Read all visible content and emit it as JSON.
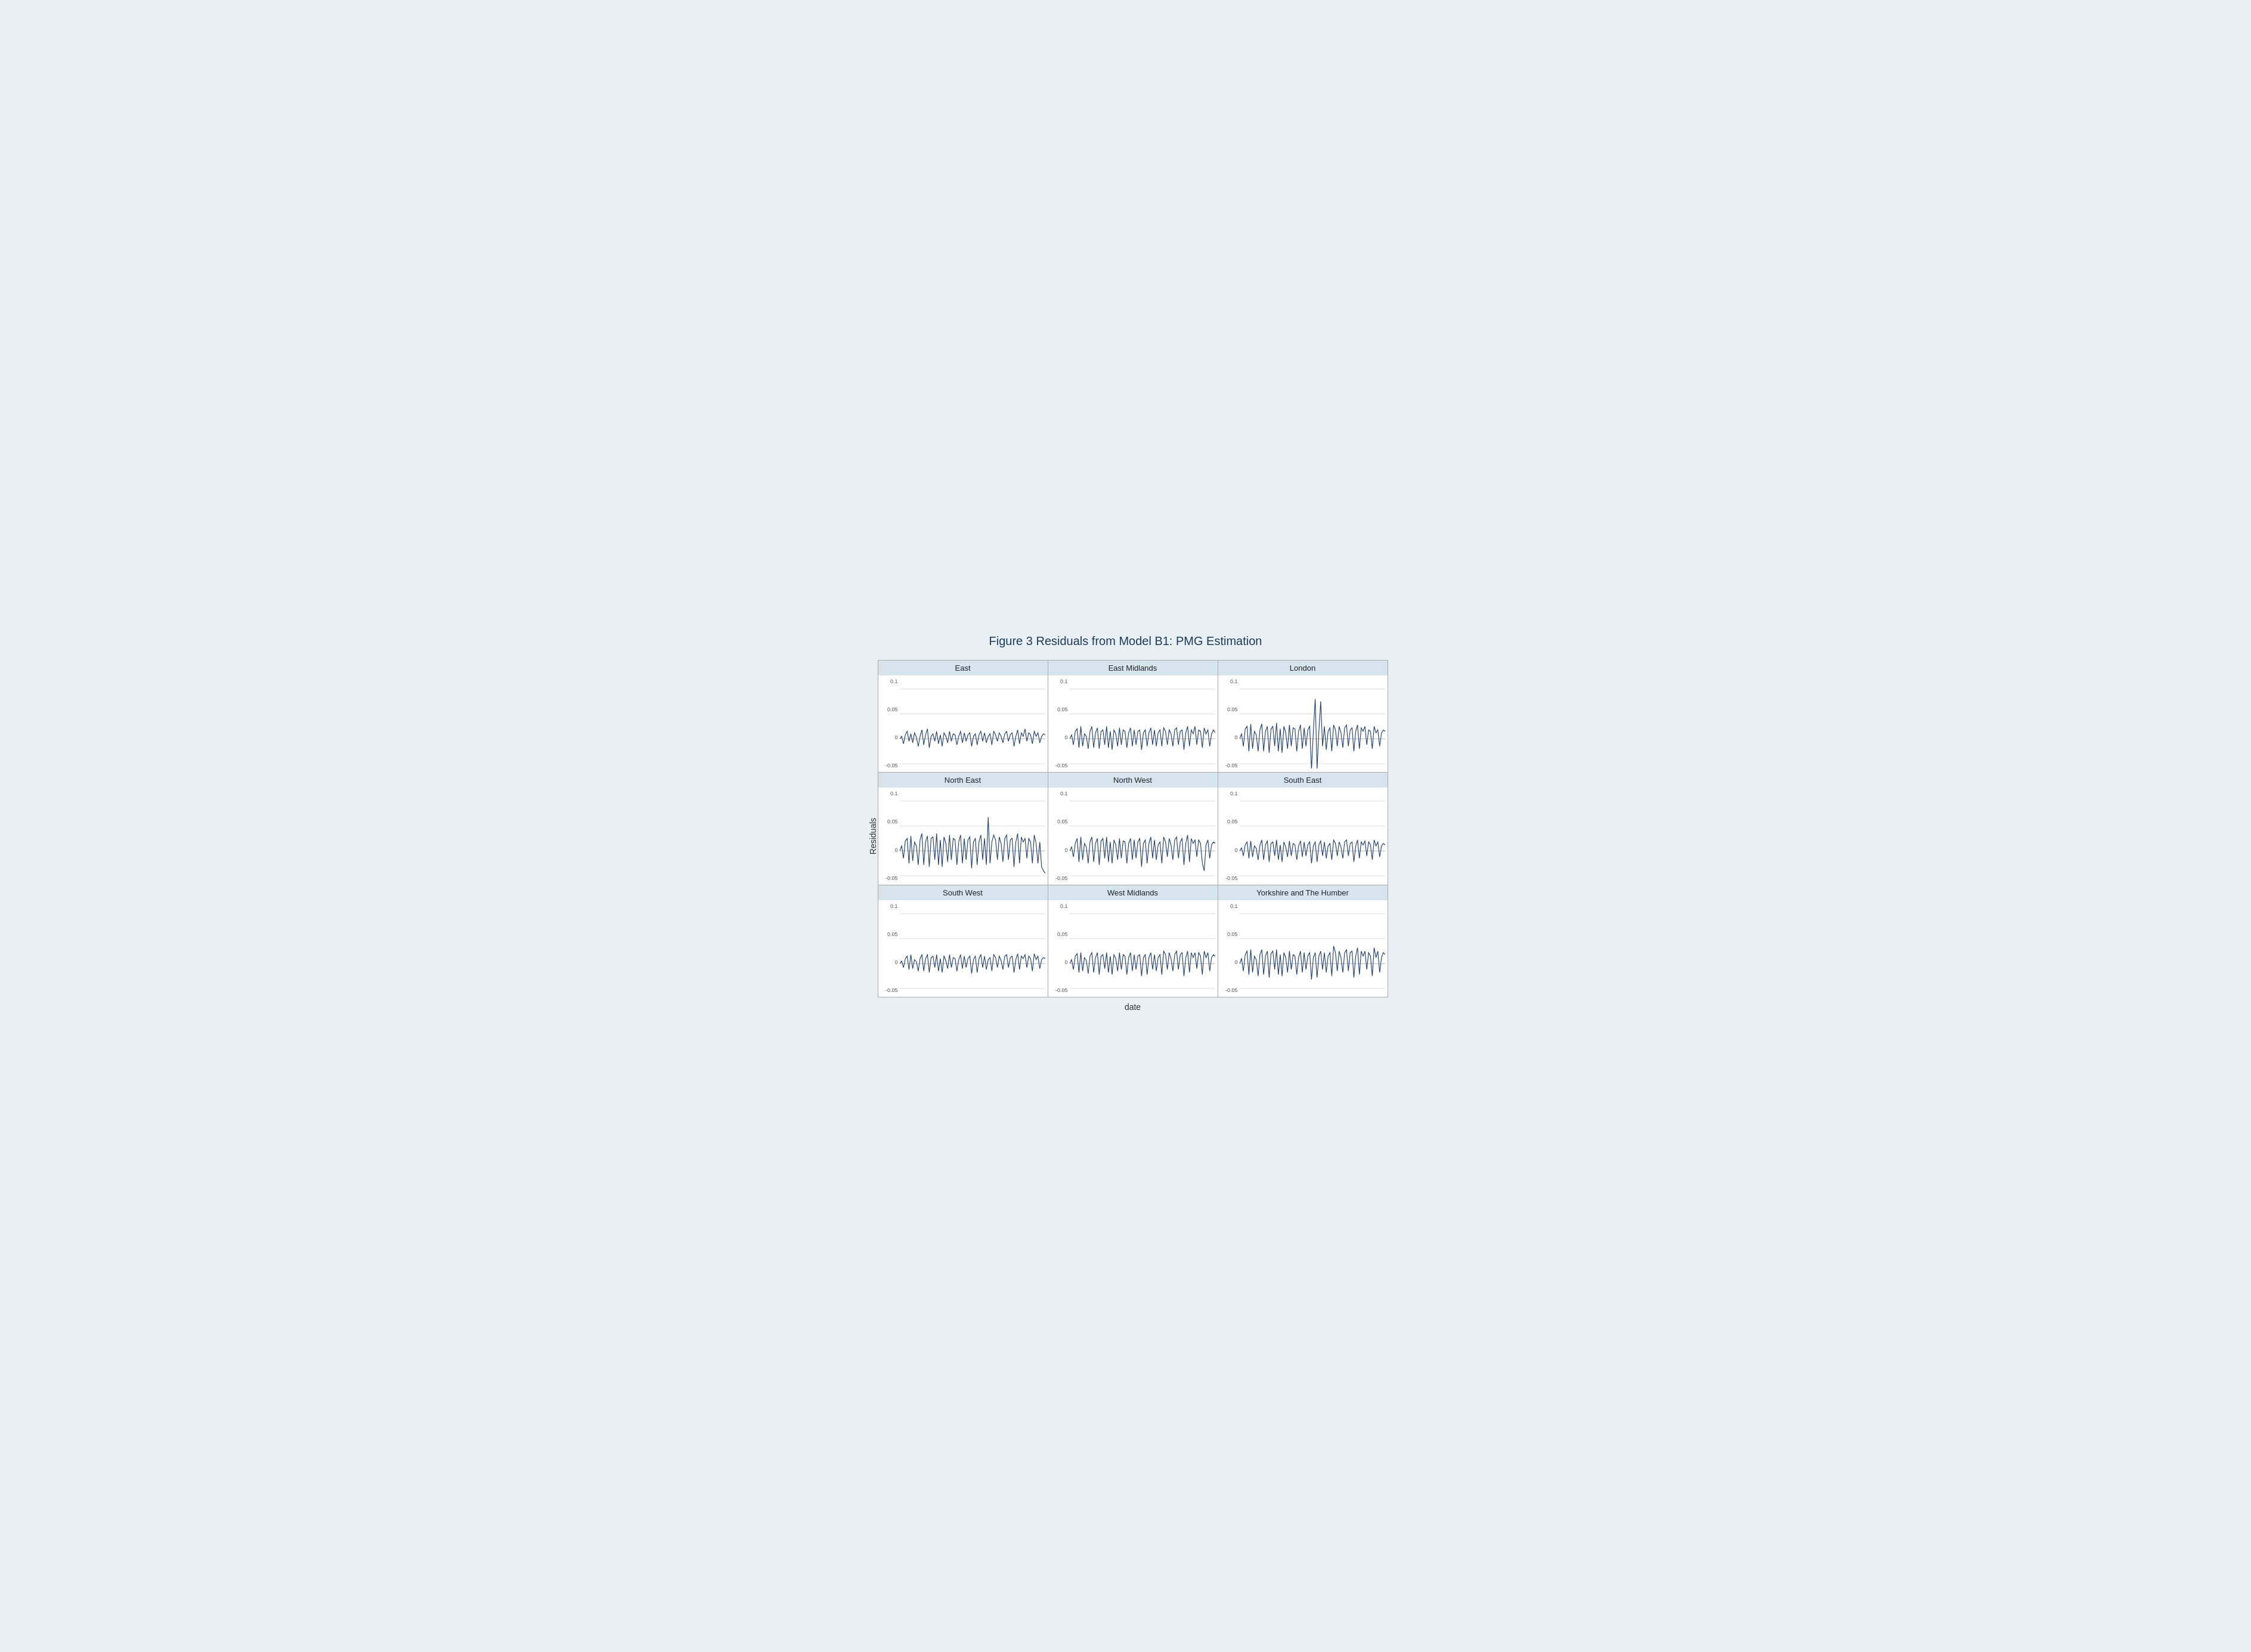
{
  "figure": {
    "title": "Figure 3 Residuals from Model B1: PMG Estimation",
    "y_axis_label": "Residuals",
    "x_axis_label": "date",
    "y_ticks": [
      "0.1",
      "0.05",
      "0",
      "-0.05"
    ],
    "panels": [
      {
        "title": "East",
        "data": [
          0,
          0.005,
          -0.01,
          0.008,
          0.015,
          -0.005,
          0.01,
          -0.008,
          0.012,
          0.003,
          -0.015,
          0.005,
          0.018,
          -0.012,
          0.008,
          0.02,
          -0.018,
          0.005,
          0.01,
          -0.005,
          0.015,
          -0.01,
          0.008,
          -0.015,
          0.012,
          0.005,
          -0.008,
          0.015,
          -0.005,
          0.01,
          0.008,
          -0.012,
          0.005,
          0.015,
          -0.008,
          0.012,
          -0.005,
          0.008,
          0.012,
          -0.015,
          0.005,
          0.01,
          -0.012,
          0.008,
          0.015,
          -0.005,
          0.012,
          -0.008,
          0.005,
          0.01,
          -0.012,
          0.015,
          0.008,
          -0.005,
          0.012,
          0.005,
          -0.008,
          0.01,
          0.015,
          -0.005,
          0.008,
          0.012,
          -0.015,
          0.005,
          0.018,
          -0.01,
          0.012,
          0.005,
          0.02,
          -0.005,
          0.012,
          0.008,
          -0.01,
          0.015,
          0.005,
          0.012,
          -0.008,
          0.005,
          0.01,
          0.008
        ]
      },
      {
        "title": "East Midlands",
        "data": [
          0,
          0.008,
          -0.012,
          0.015,
          0.02,
          -0.018,
          0.025,
          -0.015,
          0.01,
          0.005,
          -0.02,
          0.015,
          0.025,
          -0.018,
          0.012,
          0.022,
          -0.02,
          0.015,
          0.018,
          -0.012,
          0.025,
          -0.018,
          0.015,
          -0.022,
          0.018,
          0.01,
          -0.015,
          0.022,
          -0.012,
          0.018,
          0.015,
          -0.018,
          0.012,
          0.022,
          -0.015,
          0.018,
          -0.012,
          0.015,
          0.018,
          -0.022,
          0.012,
          0.018,
          -0.015,
          0.012,
          0.022,
          -0.012,
          0.018,
          -0.015,
          0.012,
          0.018,
          -0.015,
          0.022,
          0.015,
          -0.012,
          0.018,
          0.01,
          -0.015,
          0.018,
          0.022,
          -0.012,
          0.015,
          0.018,
          -0.022,
          0.012,
          0.025,
          -0.015,
          0.018,
          0.01,
          0.025,
          -0.012,
          0.018,
          0.015,
          -0.018,
          0.022,
          0.01,
          0.018,
          -0.015,
          0.01,
          0.018,
          0.012
        ]
      },
      {
        "title": "London",
        "data": [
          0,
          0.01,
          -0.015,
          0.02,
          0.025,
          -0.025,
          0.03,
          -0.02,
          0.015,
          0.008,
          -0.025,
          0.018,
          0.03,
          -0.025,
          0.015,
          0.025,
          -0.028,
          0.02,
          0.025,
          -0.015,
          0.032,
          -0.025,
          0.02,
          -0.028,
          0.025,
          0.012,
          -0.02,
          0.028,
          -0.015,
          0.022,
          0.02,
          -0.025,
          0.015,
          0.028,
          -0.02,
          0.022,
          -0.015,
          0.018,
          0.025,
          -0.062,
          0.015,
          0.08,
          -0.06,
          0.015,
          0.075,
          -0.015,
          0.025,
          -0.022,
          0.015,
          0.022,
          -0.025,
          0.028,
          0.018,
          -0.015,
          0.025,
          0.012,
          -0.018,
          0.022,
          0.028,
          -0.015,
          0.018,
          0.022,
          -0.025,
          0.015,
          0.028,
          -0.02,
          0.022,
          0.015,
          0.025,
          -0.012,
          0.018,
          0.015,
          -0.02,
          0.025,
          0.012,
          0.018,
          -0.015,
          0.012,
          0.018,
          0.015
        ]
      },
      {
        "title": "North East",
        "data": [
          0,
          0.01,
          -0.015,
          0.02,
          0.025,
          -0.025,
          0.03,
          -0.02,
          0.018,
          0.01,
          -0.028,
          0.022,
          0.035,
          -0.028,
          0.018,
          0.03,
          -0.032,
          0.025,
          0.028,
          -0.018,
          0.035,
          -0.028,
          0.022,
          -0.032,
          0.028,
          0.015,
          -0.022,
          0.032,
          -0.018,
          0.025,
          0.022,
          -0.028,
          0.018,
          0.032,
          -0.025,
          0.025,
          -0.018,
          0.022,
          0.028,
          -0.035,
          0.018,
          0.025,
          -0.028,
          0.018,
          0.032,
          -0.018,
          0.025,
          -0.028,
          0.068,
          -0.025,
          0.018,
          0.032,
          0.022,
          -0.018,
          0.028,
          0.015,
          -0.022,
          0.025,
          0.032,
          -0.018,
          0.022,
          0.025,
          -0.032,
          0.018,
          0.035,
          -0.025,
          0.028,
          0.018,
          0.025,
          -0.015,
          0.025,
          0.018,
          -0.025,
          0.032,
          0.015,
          -0.025,
          0.018,
          -0.032,
          -0.04,
          -0.045
        ]
      },
      {
        "title": "North West",
        "data": [
          0,
          0.008,
          -0.012,
          0.015,
          0.025,
          -0.022,
          0.028,
          -0.018,
          0.015,
          0.008,
          -0.025,
          0.018,
          0.028,
          -0.022,
          0.015,
          0.025,
          -0.028,
          0.02,
          0.025,
          -0.015,
          0.028,
          -0.022,
          0.018,
          -0.025,
          0.022,
          0.012,
          -0.018,
          0.025,
          -0.015,
          0.02,
          0.018,
          -0.025,
          0.015,
          0.025,
          -0.018,
          0.022,
          -0.015,
          0.018,
          0.025,
          -0.032,
          0.015,
          0.022,
          -0.025,
          0.015,
          0.028,
          -0.015,
          0.022,
          -0.018,
          0.012,
          0.018,
          -0.025,
          0.028,
          0.018,
          -0.012,
          0.025,
          0.012,
          -0.018,
          0.022,
          0.028,
          -0.015,
          0.018,
          0.025,
          -0.028,
          0.015,
          0.032,
          -0.022,
          0.025,
          0.015,
          0.022,
          -0.012,
          0.022,
          0.015,
          -0.025,
          -0.04,
          0.012,
          0.022,
          -0.015,
          0.012,
          0.018,
          0.015
        ]
      },
      {
        "title": "South East",
        "data": [
          0,
          0.006,
          -0.01,
          0.012,
          0.018,
          -0.015,
          0.02,
          -0.012,
          0.01,
          0.005,
          -0.018,
          0.012,
          0.022,
          -0.018,
          0.012,
          0.02,
          -0.022,
          0.015,
          0.018,
          -0.01,
          0.022,
          -0.018,
          0.012,
          -0.022,
          0.018,
          0.008,
          -0.012,
          0.02,
          -0.01,
          0.015,
          0.012,
          -0.018,
          0.01,
          0.02,
          -0.012,
          0.018,
          -0.01,
          0.012,
          0.018,
          -0.025,
          0.01,
          0.018,
          -0.022,
          0.012,
          0.02,
          -0.01,
          0.018,
          -0.015,
          0.01,
          0.015,
          -0.018,
          0.022,
          0.015,
          -0.01,
          0.018,
          0.008,
          -0.015,
          0.018,
          0.022,
          -0.01,
          0.015,
          0.018,
          -0.022,
          0.01,
          0.022,
          -0.015,
          0.018,
          0.012,
          0.02,
          -0.01,
          0.018,
          0.012,
          -0.018,
          0.022,
          0.01,
          0.018,
          -0.012,
          0.01,
          0.015,
          0.012
        ]
      },
      {
        "title": "South West",
        "data": [
          0,
          0.005,
          -0.008,
          0.01,
          0.015,
          -0.012,
          0.018,
          -0.01,
          0.008,
          0.004,
          -0.015,
          0.01,
          0.018,
          -0.015,
          0.01,
          0.018,
          -0.018,
          0.012,
          0.015,
          -0.008,
          0.018,
          -0.015,
          0.01,
          -0.018,
          0.015,
          0.006,
          -0.01,
          0.018,
          -0.008,
          0.012,
          0.01,
          -0.015,
          0.008,
          0.018,
          -0.01,
          0.015,
          -0.008,
          0.01,
          0.015,
          -0.02,
          0.008,
          0.015,
          -0.018,
          0.01,
          0.018,
          -0.008,
          0.015,
          -0.012,
          0.008,
          0.012,
          -0.015,
          0.018,
          0.012,
          -0.008,
          0.015,
          0.006,
          -0.012,
          0.015,
          0.018,
          -0.008,
          0.012,
          0.015,
          -0.018,
          0.008,
          0.02,
          -0.012,
          0.015,
          0.01,
          0.018,
          -0.008,
          0.015,
          0.01,
          -0.015,
          0.02,
          0.008,
          0.015,
          -0.01,
          0.008,
          0.012,
          0.01
        ]
      },
      {
        "title": "West Midlands",
        "data": [
          0,
          0.008,
          -0.012,
          0.015,
          0.02,
          -0.018,
          0.022,
          -0.015,
          0.012,
          0.006,
          -0.02,
          0.015,
          0.022,
          -0.018,
          0.012,
          0.022,
          -0.022,
          0.015,
          0.018,
          -0.01,
          0.022,
          -0.018,
          0.015,
          -0.022,
          0.018,
          0.01,
          -0.015,
          0.022,
          -0.012,
          0.018,
          0.015,
          -0.022,
          0.012,
          0.022,
          -0.015,
          0.018,
          -0.012,
          0.015,
          0.018,
          -0.025,
          0.012,
          0.018,
          -0.022,
          0.012,
          0.022,
          -0.012,
          0.018,
          -0.015,
          0.012,
          0.018,
          -0.022,
          0.025,
          0.018,
          -0.012,
          0.022,
          0.01,
          -0.015,
          0.018,
          0.025,
          -0.012,
          0.018,
          0.022,
          -0.025,
          0.012,
          0.025,
          -0.018,
          0.022,
          0.012,
          0.022,
          -0.01,
          0.022,
          0.015,
          -0.022,
          0.025,
          0.012,
          0.022,
          -0.015,
          0.012,
          0.018,
          0.015
        ]
      },
      {
        "title": "Yorkshire and The Humber",
        "data": [
          0,
          0.01,
          -0.015,
          0.018,
          0.025,
          -0.022,
          0.028,
          -0.018,
          0.015,
          0.008,
          -0.025,
          0.018,
          0.028,
          -0.022,
          0.015,
          0.025,
          -0.028,
          0.02,
          0.025,
          -0.012,
          0.028,
          -0.022,
          0.018,
          -0.025,
          0.022,
          0.012,
          -0.018,
          0.025,
          -0.012,
          0.018,
          0.015,
          -0.022,
          0.012,
          0.025,
          -0.018,
          0.022,
          -0.012,
          0.015,
          0.022,
          -0.032,
          0.012,
          0.022,
          -0.028,
          0.015,
          0.025,
          -0.012,
          0.022,
          -0.018,
          0.015,
          0.022,
          -0.025,
          0.035,
          0.022,
          -0.015,
          0.025,
          0.012,
          -0.018,
          0.022,
          0.028,
          -0.015,
          0.022,
          0.025,
          -0.028,
          0.015,
          0.032,
          -0.022,
          0.025,
          0.015,
          0.025,
          -0.012,
          0.022,
          0.015,
          -0.025,
          0.032,
          0.012,
          0.025,
          -0.018,
          0.012,
          0.022,
          0.018
        ]
      }
    ]
  }
}
